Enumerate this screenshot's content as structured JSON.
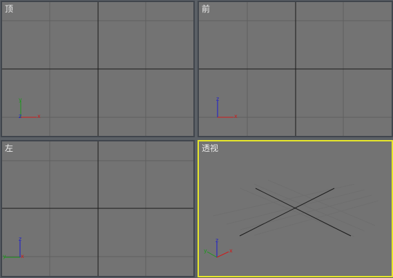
{
  "viewports": {
    "top": {
      "label": "顶",
      "axis_h": "x",
      "axis_v": "y",
      "axis_center": "z"
    },
    "front": {
      "label": "前",
      "axis_h": "x",
      "axis_v": "z"
    },
    "left": {
      "label": "左",
      "axis_h": "x",
      "axis_v": "z",
      "axis_left": "y"
    },
    "perspective": {
      "label": "透视",
      "axis_h": "x",
      "axis_v": "z",
      "axis_left": "y",
      "active": true
    }
  },
  "colors": {
    "viewport_bg": "#737373",
    "grid_line": "#5f5f5f",
    "world_axis_line": "#1a1a1a",
    "active_border": "#e8e82a",
    "axis_x": "#d01a1a",
    "axis_y": "#1a9a1a",
    "axis_z": "#1a1ad0"
  }
}
